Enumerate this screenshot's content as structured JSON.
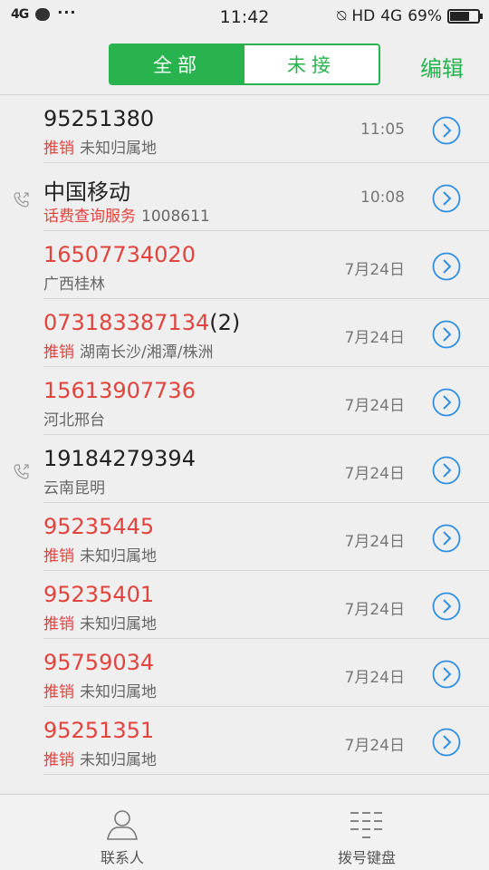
{
  "status_bar": {
    "network": "4G",
    "time": "11:42",
    "hd": "HD",
    "net_right": "4G",
    "battery_text": "69%",
    "battery_level": 0.69
  },
  "header": {
    "tabs": [
      {
        "label": "全部",
        "active": true
      },
      {
        "label": "未接",
        "active": false
      }
    ],
    "edit_label": "编辑",
    "accent_color": "#28b34e"
  },
  "calls": [
    {
      "name": "95251380",
      "count": "",
      "missed": false,
      "tag": "推销",
      "location": "未知归属地",
      "time": "11:05",
      "outgoing": false
    },
    {
      "name": "中国移动",
      "count": "",
      "missed": false,
      "tag": "话费查询服务",
      "location": "1008611",
      "time": "10:08",
      "outgoing": true
    },
    {
      "name": "16507734020",
      "count": "",
      "missed": true,
      "tag": "",
      "location": "广西桂林",
      "time": "7月24日",
      "outgoing": false
    },
    {
      "name": "073183387134",
      "count": "(2)",
      "missed": true,
      "tag": "推销",
      "location": "湖南长沙/湘潭/株洲",
      "time": "7月24日",
      "outgoing": false
    },
    {
      "name": "15613907736",
      "count": "",
      "missed": true,
      "tag": "",
      "location": "河北邢台",
      "time": "7月24日",
      "outgoing": false
    },
    {
      "name": "19184279394",
      "count": "",
      "missed": false,
      "tag": "",
      "location": "云南昆明",
      "time": "7月24日",
      "outgoing": true
    },
    {
      "name": "95235445",
      "count": "",
      "missed": true,
      "tag": "推销",
      "location": "未知归属地",
      "time": "7月24日",
      "outgoing": false
    },
    {
      "name": "95235401",
      "count": "",
      "missed": true,
      "tag": "推销",
      "location": "未知归属地",
      "time": "7月24日",
      "outgoing": false
    },
    {
      "name": "95759034",
      "count": "",
      "missed": true,
      "tag": "推销",
      "location": "未知归属地",
      "time": "7月24日",
      "outgoing": false
    },
    {
      "name": "95251351",
      "count": "",
      "missed": true,
      "tag": "推销",
      "location": "未知归属地",
      "time": "7月24日",
      "outgoing": false
    }
  ],
  "bottom_tabs": [
    {
      "label": "联系人",
      "icon": "person-icon"
    },
    {
      "label": "拨号键盘",
      "icon": "dialpad-icon"
    }
  ]
}
